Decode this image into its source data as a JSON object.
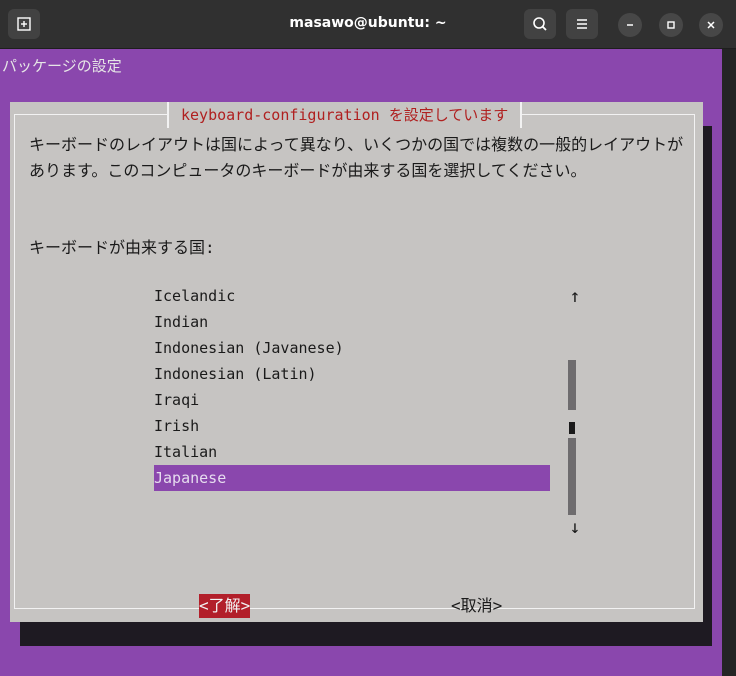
{
  "window": {
    "title": "masawo@ubuntu: ~"
  },
  "terminal": {
    "backtitle": "パッケージの設定"
  },
  "dialog": {
    "title": "keyboard-configuration を設定しています",
    "description": "キーボードのレイアウトは国によって異なり、いくつかの国では複数の一般的レイアウトがあります。このコンピュータのキーボードが由来する国を選択してください。",
    "prompt": "キーボードが由来する国:",
    "list": [
      "Icelandic",
      "Indian",
      "Indonesian (Javanese)",
      "Indonesian (Latin)",
      "Iraqi",
      "Irish",
      "Italian",
      "Japanese"
    ],
    "selected": "Japanese",
    "ok_label": "<了解>",
    "cancel_label": "<取消>",
    "scroll_up": "↑",
    "scroll_down": "↓"
  },
  "colors": {
    "terminal_bg": "#8a47ad",
    "dialog_bg": "#c6c4c2",
    "title_red": "#b02020",
    "ok_bg": "#b21f2a"
  },
  "icons": {
    "new_tab": "new-tab-icon",
    "search": "search-icon",
    "menu": "hamburger-menu-icon",
    "minimize": "minimize-icon",
    "maximize": "maximize-icon",
    "close": "close-icon"
  }
}
